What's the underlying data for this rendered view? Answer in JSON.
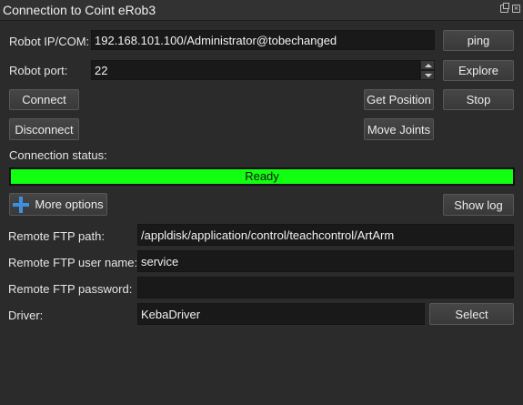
{
  "window": {
    "title": "Connection to Coint eRob3"
  },
  "connection": {
    "ip_label": "Robot IP/COM:",
    "ip_value": "192.168.101.100/Administrator@tobechanged",
    "port_label": "Robot port:",
    "port_value": "22",
    "ping_label": "ping",
    "explore_label": "Explore",
    "connect_label": "Connect",
    "disconnect_label": "Disconnect",
    "get_position_label": "Get Position",
    "move_joints_label": "Move Joints",
    "stop_label": "Stop",
    "status_label": "Connection status:",
    "status_text": "Ready",
    "status_progress": 1.0,
    "status_color": "#12ff12"
  },
  "options": {
    "more_options_label": "More options",
    "show_log_label": "Show log"
  },
  "ftp": {
    "path_label": "Remote FTP path:",
    "path_value": "/appldisk/application/control/teachcontrol/ArtArm",
    "user_label": "Remote FTP user name:",
    "user_value": "service",
    "password_label": "Remote FTP password:",
    "password_value": "",
    "driver_label": "Driver:",
    "driver_value": "KebaDriver",
    "select_label": "Select"
  },
  "icons": {
    "more_options": "plus-icon",
    "float_window": "float-window-icon",
    "close_window": "close-icon"
  }
}
